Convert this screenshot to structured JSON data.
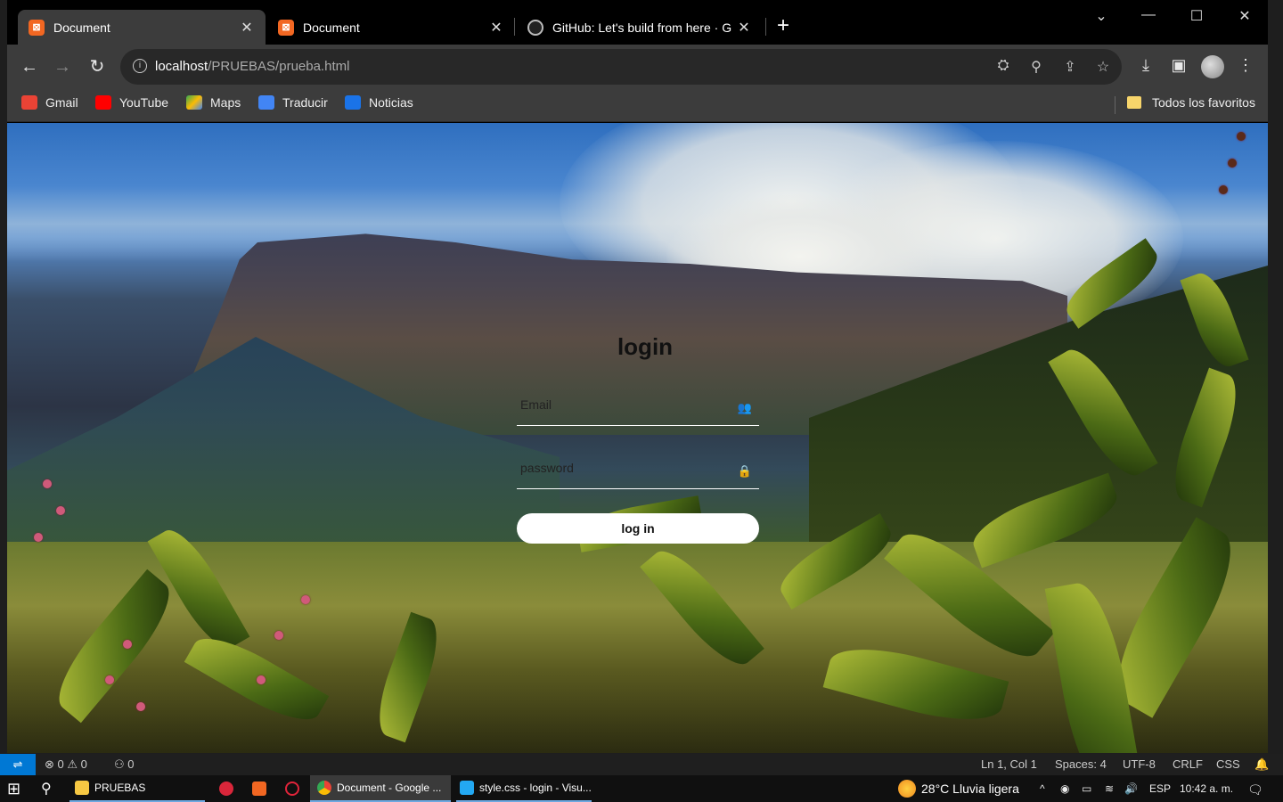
{
  "browser": {
    "tabs": [
      {
        "title": "Document",
        "active": true
      },
      {
        "title": "Document",
        "active": false
      },
      {
        "title": "GitHub: Let's build from here · G",
        "active": false
      }
    ],
    "new_tab_symbol": "+",
    "url_host": "localhost",
    "url_path": "/PRUEBAS/prueba.html",
    "bookmarks": [
      {
        "label": "Gmail",
        "icon": "gmail-icon",
        "color": "#ea4335"
      },
      {
        "label": "YouTube",
        "icon": "youtube-icon",
        "color": "#ff0000"
      },
      {
        "label": "Maps",
        "icon": "maps-icon",
        "color": "#34a853"
      },
      {
        "label": "Traducir",
        "icon": "translate-icon",
        "color": "#4285f4"
      },
      {
        "label": "Noticias",
        "icon": "news-icon",
        "color": "#1a73e8"
      }
    ],
    "all_bookmarks_label": "Todos los favoritos"
  },
  "login": {
    "title": "login",
    "email_placeholder": "Email",
    "password_placeholder": "password",
    "button_label": "log in"
  },
  "vscode_status": {
    "errors": "0",
    "warnings": "0",
    "ports": "0",
    "cursor": "Ln 1, Col 1",
    "spaces": "Spaces: 4",
    "encoding": "UTF-8",
    "eol": "CRLF",
    "language": "CSS"
  },
  "taskbar": {
    "folder_label": "PRUEBAS",
    "chrome_label": "Document - Google ...",
    "vscode_label": "style.css - login - Visu...",
    "weather": "28°C  Lluvia ligera",
    "language": "ESP",
    "time": "10:42 a. m."
  },
  "colors": {
    "accent_blue": "#0078d4",
    "xampp_orange": "#f26722"
  }
}
